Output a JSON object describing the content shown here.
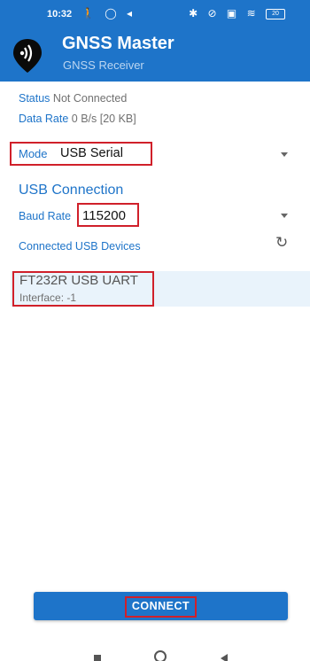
{
  "statusbar": {
    "time": "10:32",
    "left_icons": "🚶 ◯ ◂",
    "right_icons": "✱ ⊘ ▣ ≋",
    "battery": "20"
  },
  "appbar": {
    "title": "GNSS Master",
    "subtitle": "GNSS Receiver",
    "logo_icon": "gnss-pin-logo-icon"
  },
  "info": {
    "status_label": "Status",
    "status_value": "Not Connected",
    "rate_label": "Data Rate",
    "rate_value": "0 B/s [20 KB]"
  },
  "mode": {
    "label": "Mode",
    "value": "USB Serial"
  },
  "usb": {
    "heading": "USB Connection",
    "baud_label": "Baud Rate",
    "baud_value": "115200",
    "devices_label": "Connected USB Devices",
    "refresh_icon": "↻",
    "devices": [
      {
        "name": "FT232R USB UART",
        "interface": "Interface: -1"
      }
    ]
  },
  "actions": {
    "connect_label": "CONNECT"
  },
  "colors": {
    "accent": "#1e74c9",
    "highlight": "#d0202a",
    "selected_row": "#e9f3fb"
  }
}
